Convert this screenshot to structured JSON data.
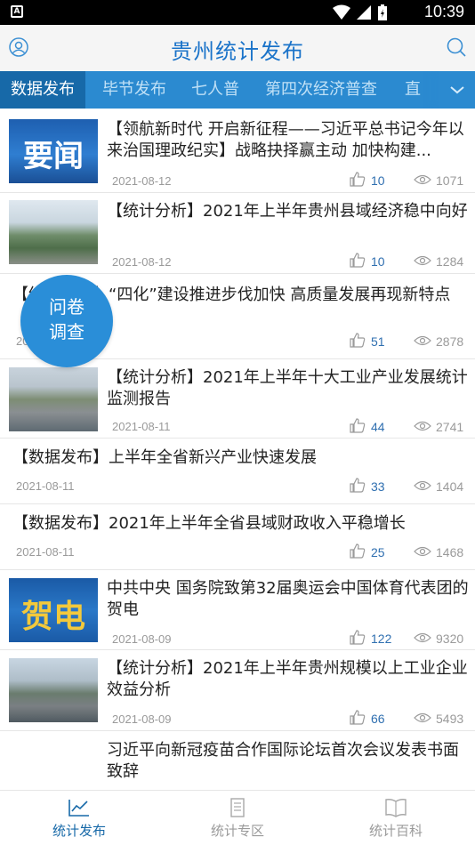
{
  "status_bar": {
    "time": "10:39",
    "app_badge": "A"
  },
  "header": {
    "title": "贵州统计发布"
  },
  "tabs": [
    {
      "label": "数据发布",
      "active": true
    },
    {
      "label": "毕节发布",
      "active": false
    },
    {
      "label": "七人普",
      "active": false
    },
    {
      "label": "第四次经济普查",
      "active": false
    },
    {
      "label": "直",
      "active": false
    }
  ],
  "thumb_labels": {
    "yaowen": "要闻",
    "hedian": "贺电"
  },
  "survey": {
    "line1": "问卷",
    "line2": "调查"
  },
  "articles": [
    {
      "title": "【领航新时代 开启新征程——习近平总书记今年以来治国理政纪实】战略抉择赢主动 加快构建...",
      "date": "2021-08-12",
      "likes": "10",
      "views": "1071"
    },
    {
      "title": "【统计分析】2021年上半年贵州县域经济稳中向好",
      "date": "2021-08-12",
      "likes": "10",
      "views": "1284"
    },
    {
      "title": "【统计分析】“四化”建设推进步伐加快 高质量发展再现新特点",
      "date": "2021-08-11",
      "likes": "51",
      "views": "2878"
    },
    {
      "title": "【统计分析】2021年上半年十大工业产业发展统计监测报告",
      "date": "2021-08-11",
      "likes": "44",
      "views": "2741"
    },
    {
      "title": "【数据发布】上半年全省新兴产业快速发展",
      "date": "2021-08-11",
      "likes": "33",
      "views": "1404"
    },
    {
      "title": "【数据发布】2021年上半年全省县域财政收入平稳增长",
      "date": "2021-08-11",
      "likes": "25",
      "views": "1468"
    },
    {
      "title": "中共中央 国务院致第32届奥运会中国体育代表团的贺电",
      "date": "2021-08-09",
      "likes": "122",
      "views": "9320"
    },
    {
      "title": "【统计分析】2021年上半年贵州规模以上工业企业效益分析",
      "date": "2021-08-09",
      "likes": "66",
      "views": "5493"
    },
    {
      "title": "习近平向新冠疫苗合作国际论坛首次会议发表书面致辞"
    }
  ],
  "bottom_nav": [
    {
      "label": "统计发布",
      "active": true
    },
    {
      "label": "统计专区",
      "active": false
    },
    {
      "label": "统计百科",
      "active": false
    }
  ],
  "colors": {
    "brand": "#1a73c9",
    "tabbar": "#2b8ad0",
    "tab_active": "#1769a8",
    "survey": "#2a8ed8"
  }
}
